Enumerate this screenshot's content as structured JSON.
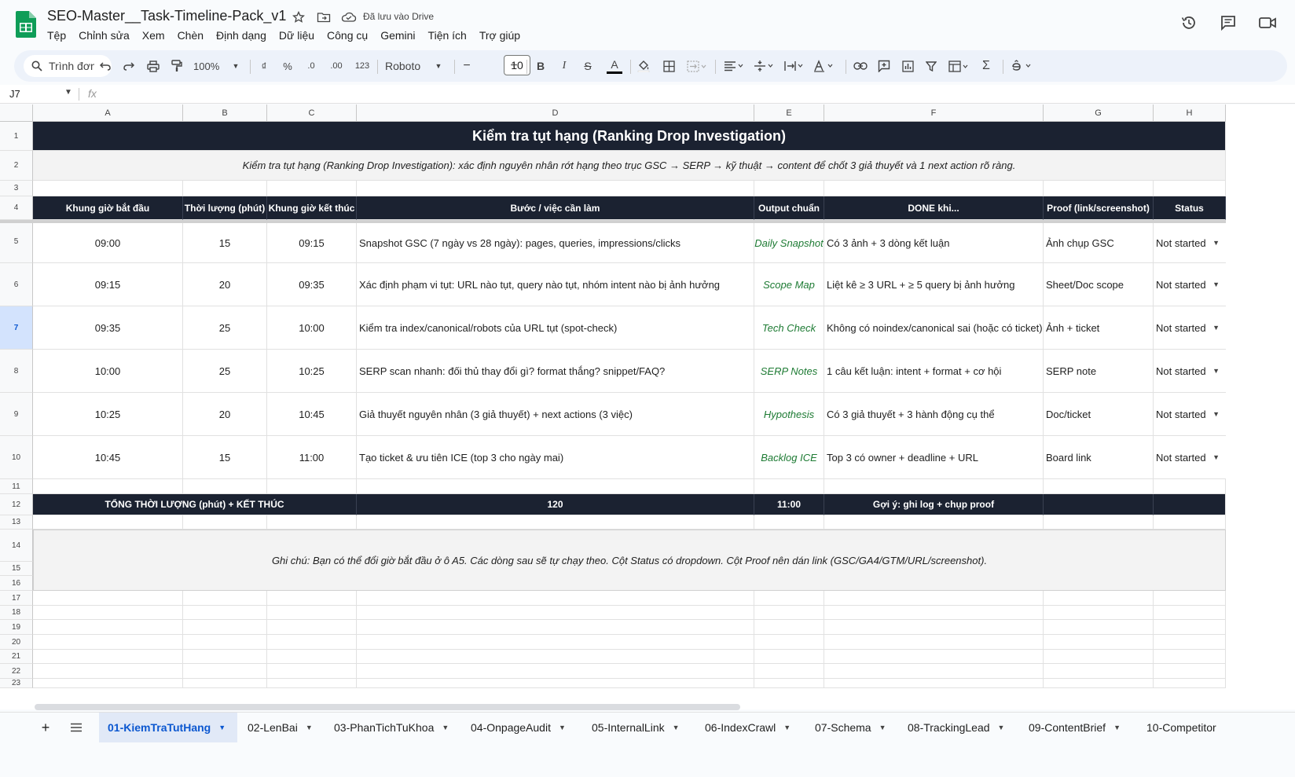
{
  "app": {
    "doc_title": "SEO-Master__Task-Timeline-Pack_v1",
    "saved_status": "Đã lưu vào Drive",
    "menus": [
      "Tệp",
      "Chỉnh sửa",
      "Xem",
      "Chèn",
      "Định dạng",
      "Dữ liệu",
      "Công cụ",
      "Gemini",
      "Tiện ích",
      "Trợ giúp"
    ]
  },
  "toolbar": {
    "search_menus": "Trình đơn",
    "zoom": "100%",
    "currency": "₫",
    "percent": "%",
    "dec_decrease": ".0",
    "dec_increase": ".00",
    "number_format": "123",
    "font": "Roboto",
    "font_size": "10",
    "minus": "−",
    "plus": "+",
    "bold": "B",
    "italic": "I",
    "strike": "S",
    "text_color": "A",
    "sum": "Σ"
  },
  "formula": {
    "name_box": "J7",
    "fx": "fx"
  },
  "columns": [
    "A",
    "B",
    "C",
    "D",
    "E",
    "F",
    "G",
    "H"
  ],
  "rows": [
    "1",
    "2",
    "3",
    "4",
    "5",
    "6",
    "7",
    "8",
    "9",
    "10",
    "11",
    "12",
    "13",
    "14",
    "15",
    "16",
    "17",
    "18",
    "19",
    "20",
    "21",
    "22",
    "23"
  ],
  "sheet": {
    "title": "Kiểm tra tụt hạng (Ranking Drop Investigation)",
    "subtitle": "Kiểm tra tụt hạng (Ranking Drop Investigation): xác định nguyên nhân rớt hạng theo trục GSC → SERP → kỹ thuật → content để chốt 3 giả thuyết và 1 next action rõ ràng.",
    "headers": [
      "Khung giờ bắt đầu",
      "Thời lượng (phút)",
      "Khung giờ kết thúc",
      "Bước / việc cần làm",
      "Output chuẩn",
      "DONE khi...",
      "Proof (link/screenshot)",
      "Status"
    ],
    "tasks": [
      {
        "start": "09:00",
        "dur": "15",
        "end": "09:15",
        "step": "Snapshot GSC (7 ngày vs 28 ngày): pages, queries, impressions/clicks",
        "output": "Daily Snapshot",
        "done": "Có 3 ảnh + 3 dòng kết luận",
        "proof": "Ảnh chụp GSC",
        "status": "Not started"
      },
      {
        "start": "09:15",
        "dur": "20",
        "end": "09:35",
        "step": "Xác định phạm vi tụt: URL nào tụt, query nào tụt, nhóm intent nào bị ảnh hưởng",
        "output": "Scope Map",
        "done": "Liệt kê ≥ 3 URL + ≥ 5 query bị ảnh hưởng",
        "proof": "Sheet/Doc scope",
        "status": "Not started"
      },
      {
        "start": "09:35",
        "dur": "25",
        "end": "10:00",
        "step": "Kiểm tra index/canonical/robots của URL tụt (spot-check)",
        "output": "Tech Check",
        "done": "Không có noindex/canonical sai (hoặc có ticket)",
        "proof": "Ảnh + ticket",
        "status": "Not started"
      },
      {
        "start": "10:00",
        "dur": "25",
        "end": "10:25",
        "step": "SERP scan nhanh: đối thủ thay đổi gì? format thắng? snippet/FAQ?",
        "output": "SERP Notes",
        "done": "1 câu kết luận: intent + format + cơ hội",
        "proof": "SERP note",
        "status": "Not started"
      },
      {
        "start": "10:25",
        "dur": "20",
        "end": "10:45",
        "step": "Giả thuyết nguyên nhân (3 giả thuyết) + next actions (3 việc)",
        "output": "Hypothesis",
        "done": "Có 3 giả thuyết + 3 hành động cụ thể",
        "proof": "Doc/ticket",
        "status": "Not started"
      },
      {
        "start": "10:45",
        "dur": "15",
        "end": "11:00",
        "step": "Tạo ticket & ưu tiên ICE (top 3 cho ngày mai)",
        "output": "Backlog ICE",
        "done": "Top 3 có owner + deadline + URL",
        "proof": "Board link",
        "status": "Not started"
      }
    ],
    "total": {
      "label": "TỔNG THỜI LƯỢNG (phút) + KẾT THÚC",
      "minutes": "120",
      "end": "11:00",
      "hint": "Gợi ý: ghi log + chụp proof"
    },
    "note": "Ghi chú: Bạn có thể đổi giờ bắt đầu ở ô A5. Các dòng sau sẽ tự chạy theo. Cột Status có dropdown. Cột Proof nên dán link (GSC/GA4/GTM/URL/screenshot)."
  },
  "tabs": [
    {
      "label": "01-KiemTraTutHang",
      "active": true
    },
    {
      "label": "02-LenBai"
    },
    {
      "label": "03-PhanTichTuKhoa"
    },
    {
      "label": "04-OnpageAudit"
    },
    {
      "label": "05-InternalLink"
    },
    {
      "label": "06-IndexCrawl"
    },
    {
      "label": "07-Schema"
    },
    {
      "label": "08-TrackingLead"
    },
    {
      "label": "09-ContentBrief"
    },
    {
      "label": "10-Competitor"
    }
  ],
  "colors": {
    "dark_header": "#1b2231",
    "output_green": "#1e7b34",
    "active_tab": "#0b57d0",
    "toolbar_bg": "#edf2fa"
  }
}
